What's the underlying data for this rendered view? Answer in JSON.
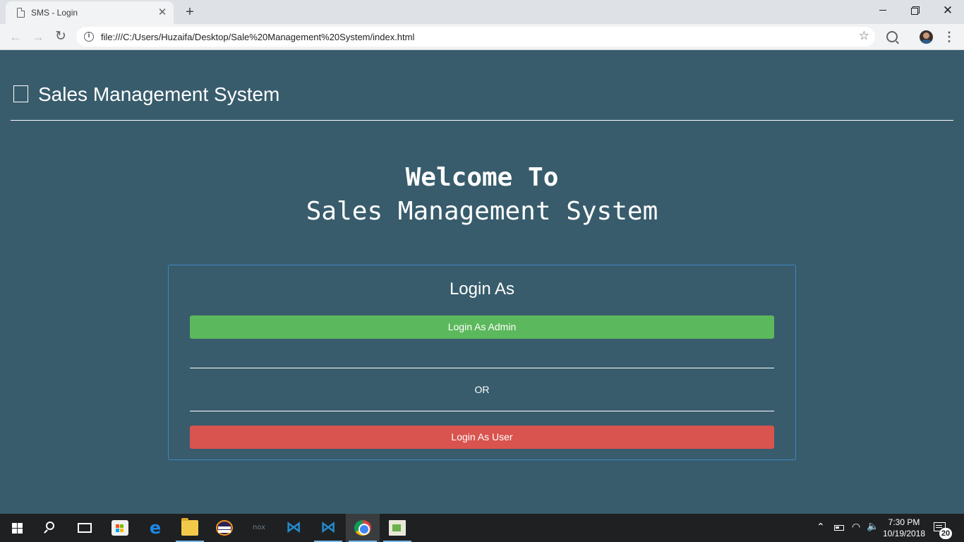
{
  "browser": {
    "tab_title": "SMS - Login",
    "tab_close": "✕",
    "new_tab": "+",
    "window_close": "✕",
    "url": "file:///C:/Users/Huzaifa/Desktop/Sale%20Management%20System/index.html",
    "back_icon": "←",
    "forward_icon": "→",
    "reload_icon": "↻",
    "info_icon": "i",
    "star_icon": "☆",
    "menu_icon": "⋮"
  },
  "page": {
    "brand_title": "Sales Management System",
    "welcome": "Welcome To",
    "subtitle": "Sales Management System",
    "login_card": {
      "title": "Login As",
      "admin_button": "Login As Admin",
      "or_text": "OR",
      "user_button": "Login As User"
    }
  },
  "taskbar": {
    "apps": [
      "start",
      "search",
      "task-view",
      "store",
      "edge",
      "file-explorer",
      "eclipse",
      "nox",
      "vscode",
      "vscode",
      "chrome",
      "notepad"
    ],
    "edge_glyph": "e",
    "nox_glyph": "nox",
    "vs_glyph": "⋈",
    "tray_chevron": "⌃",
    "wifi_glyph": "◠",
    "volume_glyph": "🔈",
    "time": "7:30 PM",
    "date": "10/19/2018",
    "notification_count": "20"
  },
  "colors": {
    "page_background": "#385c6c",
    "admin_button": "#5cb85c",
    "user_button": "#d9534f",
    "card_border": "#3f86c2",
    "taskbar": "#1e2022"
  }
}
